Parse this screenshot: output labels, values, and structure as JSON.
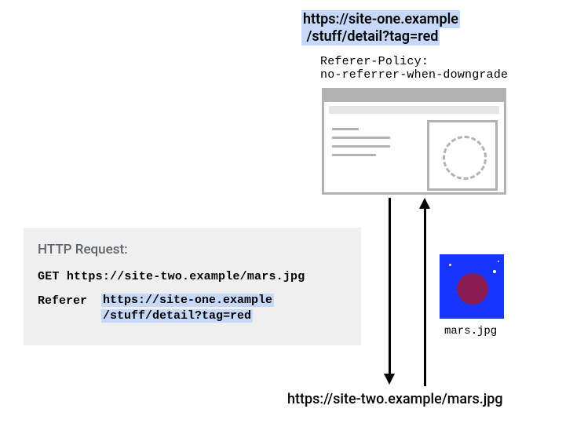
{
  "top_url": {
    "line1": "https://site-one.example",
    "line2": "/stuff/detail?tag=red"
  },
  "policy": {
    "line1": "Referer-Policy:",
    "line2": "no-referrer-when-downgrade"
  },
  "request": {
    "caption": "HTTP Request:",
    "method": "GET",
    "url": "https://site-two.example/mars.jpg",
    "referer_key": "Referer",
    "referer_val_line1": "https://site-one.example",
    "referer_val_line2": "/stuff/detail?tag=red"
  },
  "bottom_url": "https://site-two.example/mars.jpg",
  "mars_label": "mars.jpg"
}
